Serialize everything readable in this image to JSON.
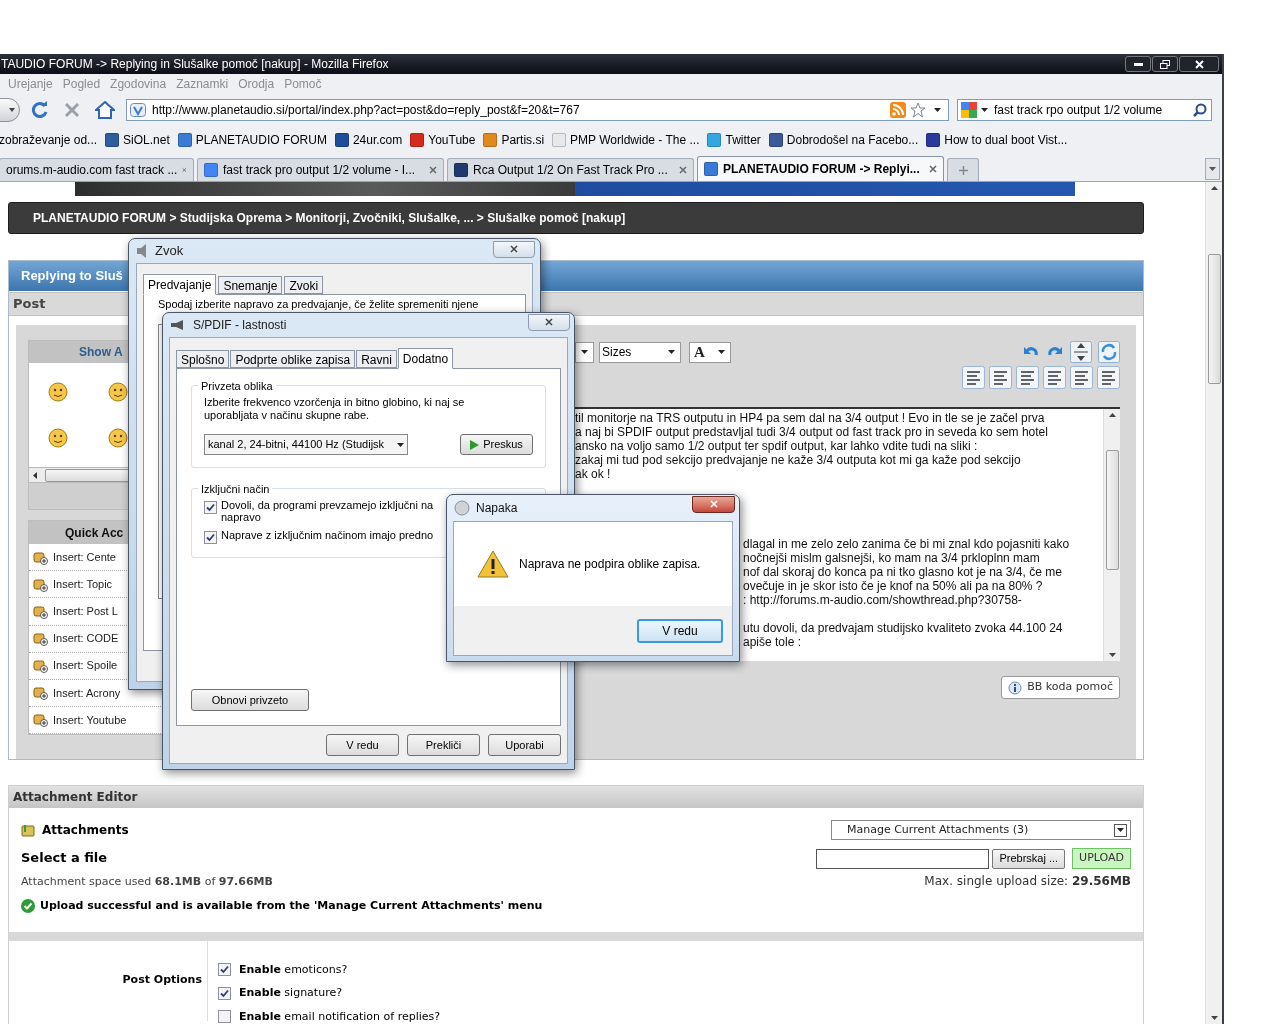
{
  "browser": {
    "title": "TAUDIO FORUM -> Replying in Slušalke pomoč [nakup] - Mozilla Firefox",
    "menu": [
      "Urejanje",
      "Pogled",
      "Zgodovina",
      "Zaznamki",
      "Orodja",
      "Pomoč"
    ],
    "url": "http://www.planetaudio.si/portal/index.php?act=post&do=reply_post&f=20&t=767",
    "search": "fast track rpo output 1/2 volume",
    "bookmarks": [
      {
        "label": "zobraževanje od..."
      },
      {
        "label": "SiOL.net",
        "color": "#2f5e9e"
      },
      {
        "label": "PLANETAUDIO FORUM",
        "color": "#3a7bd5"
      },
      {
        "label": "24ur.com",
        "color": "#1d4e9a"
      },
      {
        "label": "YouTube",
        "color": "#d62a1e"
      },
      {
        "label": "Partis.si",
        "color": "#e08a1e"
      },
      {
        "label": "PMP Worldwide - The ...",
        "color": "#e8e8e8"
      },
      {
        "label": "Twitter",
        "color": "#35a6e0"
      },
      {
        "label": "Dobrodošel na Facebo...",
        "color": "#3b5998"
      },
      {
        "label": "How to dual boot Vist...",
        "color": "#2a3a9c"
      }
    ],
    "tabs": [
      {
        "label": "orums.m-audio.com fast track ...",
        "selected": false
      },
      {
        "label": "fast track pro output 1/2 volume - I...",
        "selected": false,
        "color": "#4285f4"
      },
      {
        "label": "Rca Output 1/2 On Fast Track Pro ...",
        "selected": false,
        "color": "#1f3b6e"
      },
      {
        "label": "PLANETAUDIO FORUM -> Replyi...",
        "selected": true,
        "color": "#3a7bd5"
      }
    ]
  },
  "page": {
    "breadcrumb": "PLANETAUDIO FORUM > Studijska Oprema > Monitorji, Zvočniki, Slušalke, ... > Slušalke pomoč [nakup]",
    "reply_header": "Replying to Sluš",
    "post_label": "Post",
    "emoticons_title": "Show A",
    "quick_title": "Quick Acc",
    "quick_items": [
      "Insert: Cente",
      "Insert: Topic",
      "Insert: Post L",
      "Insert: CODE",
      "Insert: Spoile",
      "Insert: Acrony",
      "Insert: Youtube"
    ],
    "size_select": "Sizes",
    "color_select": "A",
    "text_lines_top": [
      "til monitorje na TRS outputu in HP4 pa sem dal na 3/4 output ! Evo in tle se je začel prva",
      "a naj bi SPDIF output predstavljal tudi 3/4 output od fast track pro in seveda ko sem hotel",
      "ansko na voljo samo 1/2 output ter spdif output, kar lahko vdite tudi na sliki :",
      "zakaj mi tud pod sekcijo predvajanje ne kaže 3/4 outputa kot mi ga kaže pod sekcijo",
      "ak ok !"
    ],
    "text_lines_middle": [
      "dlagal in me zelo zelo zanima če bi mi znal kdo pojasniti kako",
      "nočnejši mislm galsnejši, ko mam na 3/4 prkloplnn mam",
      "nof dal skoraj do konca pa ni tko glasno kot je na 3/4, če me",
      "ovečuje in je skor isto če je knof na 50% ali pa na 80% ?",
      ": http://forums.m-audio.com/showthread.php?30758-"
    ],
    "text_lines_end": [
      "utu dovoli, da predvajam studijsko kvaliteto zvoka 44.100 24",
      "apiše tole :"
    ],
    "bb_help": "BB koda pomoč",
    "attachments": {
      "header": "Attachment Editor",
      "title": "Attachments",
      "manage": "Manage Current Attachments (3)",
      "select_file": "Select a file",
      "browse": "Prebrskaj ...",
      "upload": "UPLOAD",
      "space": "Attachment space used **68.1MB** of **97.66MB**",
      "max": "Max. single upload size: **29.56MB**",
      "success": "Upload successful and is available from the 'Manage Current Attachments' menu"
    },
    "post_options": {
      "label": "Post Options",
      "options": [
        {
          "text": "**Enable** emoticons?",
          "checked": true
        },
        {
          "text": "**Enable** signature?",
          "checked": true
        },
        {
          "text": "**Enable** email notification of replies?",
          "checked": false
        }
      ]
    }
  },
  "dialogs": {
    "zvok": {
      "title": "Zvok",
      "tabs": [
        {
          "label": "Predvajanje",
          "selected": true
        },
        {
          "label": "Snemanje",
          "selected": false
        },
        {
          "label": "Zvoki",
          "selected": false
        }
      ],
      "intro": "Spodaj izberite napravo za predvajanje, če želite spremeniti njene"
    },
    "spdif": {
      "title": "S/PDIF - lastnosti",
      "tabs": [
        {
          "label": "Splošno",
          "selected": false
        },
        {
          "label": "Podprte oblike zapisa",
          "selected": false
        },
        {
          "label": "Ravni",
          "selected": false
        },
        {
          "label": "Dodatno",
          "selected": true
        }
      ],
      "group1_title": "Privzeta oblika",
      "group1_text": [
        "Izberite frekvenco vzorčenja in bitno globino, ki naj se",
        "uporabljata v načinu skupne rabe."
      ],
      "format": "kanal 2, 24-bitni, 44100 Hz (Studijsk",
      "test": "Preskus",
      "group2_title": "Izključni način",
      "options": [
        {
          "lines": [
            "Dovoli, da programi prevzamejo izključni na",
            "napravo"
          ],
          "checked": true
        },
        {
          "lines": [
            "Naprave z izključnim načinom imajo predno"
          ],
          "checked": true
        }
      ],
      "restore": "Obnovi privzeto",
      "buttons": [
        "V redu",
        "Prekliči",
        "Uporabi"
      ]
    },
    "napaka": {
      "title": "Napaka",
      "message": "Naprava ne podpira oblike zapisa.",
      "ok": "V redu"
    }
  }
}
